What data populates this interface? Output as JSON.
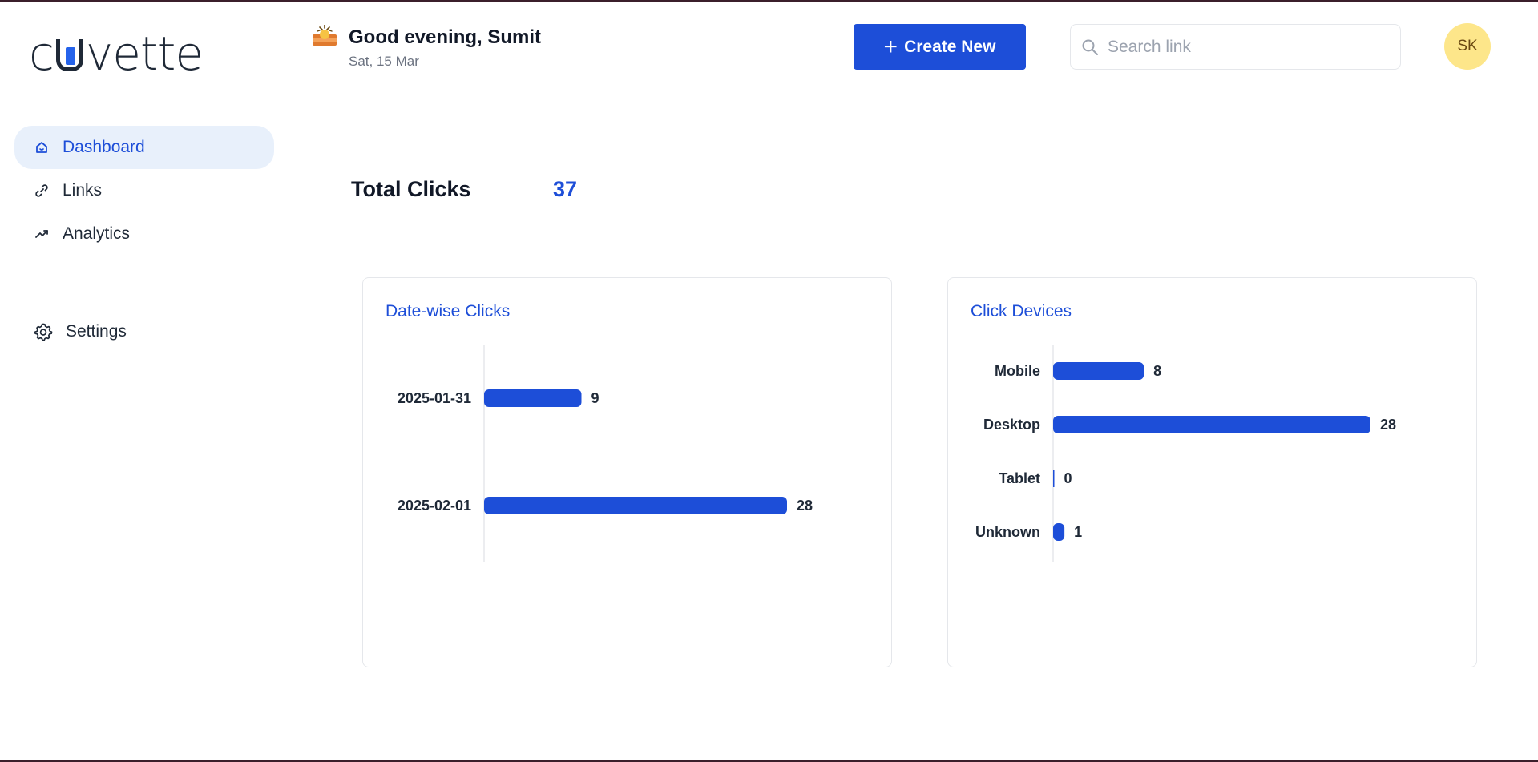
{
  "brand": {
    "logo_pre": "c",
    "logo_post": "vette"
  },
  "sidebar": {
    "items": [
      {
        "label": "Dashboard",
        "icon": "home-icon"
      },
      {
        "label": "Links",
        "icon": "link-icon"
      },
      {
        "label": "Analytics",
        "icon": "trend-icon"
      }
    ],
    "settings_label": "Settings"
  },
  "header": {
    "greeting": "Good evening, Sumit",
    "date": "Sat, 15 Mar",
    "create_label": "Create New",
    "search_placeholder": "Search link",
    "avatar_initials": "SK"
  },
  "summary": {
    "total_label": "Total Clicks",
    "total_value": "37"
  },
  "colors": {
    "accent": "#1d4ed8",
    "active_nav_bg": "#e8f0fb",
    "avatar_bg": "#fde68a"
  },
  "chart_data": [
    {
      "type": "bar",
      "orientation": "horizontal",
      "title": "Date-wise Clicks",
      "categories": [
        "2025-01-31",
        "2025-02-01"
      ],
      "values": [
        9,
        28
      ],
      "xlim": [
        0,
        28
      ]
    },
    {
      "type": "bar",
      "orientation": "horizontal",
      "title": "Click Devices",
      "categories": [
        "Mobile",
        "Desktop",
        "Tablet",
        "Unknown"
      ],
      "values": [
        8,
        28,
        0,
        1
      ],
      "xlim": [
        0,
        28
      ]
    }
  ]
}
